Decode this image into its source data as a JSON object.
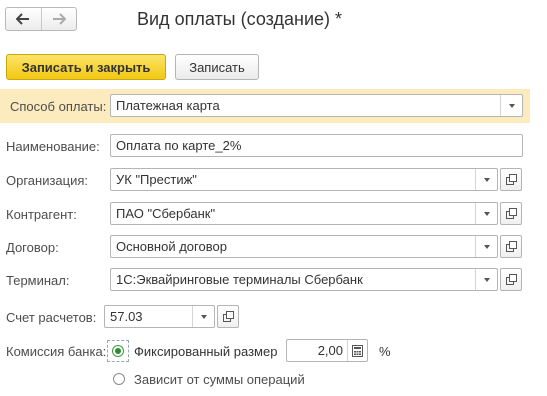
{
  "window": {
    "title": "Вид оплаты (создание) *"
  },
  "nav": {
    "back_icon": "arrow-left-icon",
    "forward_icon": "arrow-right-icon"
  },
  "toolbar": {
    "save_close_label": "Записать и закрыть",
    "save_label": "Записать"
  },
  "form": {
    "payment_method": {
      "label": "Способ оплаты:",
      "value": "Платежная карта"
    },
    "name": {
      "label": "Наименование:",
      "value": "Оплата по карте_2%"
    },
    "organization": {
      "label": "Организация:",
      "value": "УК \"Престиж\""
    },
    "counterparty": {
      "label": "Контрагент:",
      "value": "ПАО \"Сбербанк\""
    },
    "contract": {
      "label": "Договор:",
      "value": "Основной договор"
    },
    "terminal": {
      "label": "Терминал:",
      "value": "1С:Эквайринговые терминалы Сбербанк"
    },
    "account": {
      "label": "Счет расчетов:",
      "value": "57.03"
    },
    "bank_fee": {
      "label": "Комиссия банка:",
      "option_fixed": "Фиксированный размер",
      "option_fixed_selected": true,
      "option_depends": "Зависит от суммы операций",
      "value": "2,00",
      "unit": "%"
    }
  },
  "colors": {
    "primary_button": "#f2c813",
    "highlight_row": "#fbebbe",
    "radio_selected": "#2e8b2e"
  }
}
